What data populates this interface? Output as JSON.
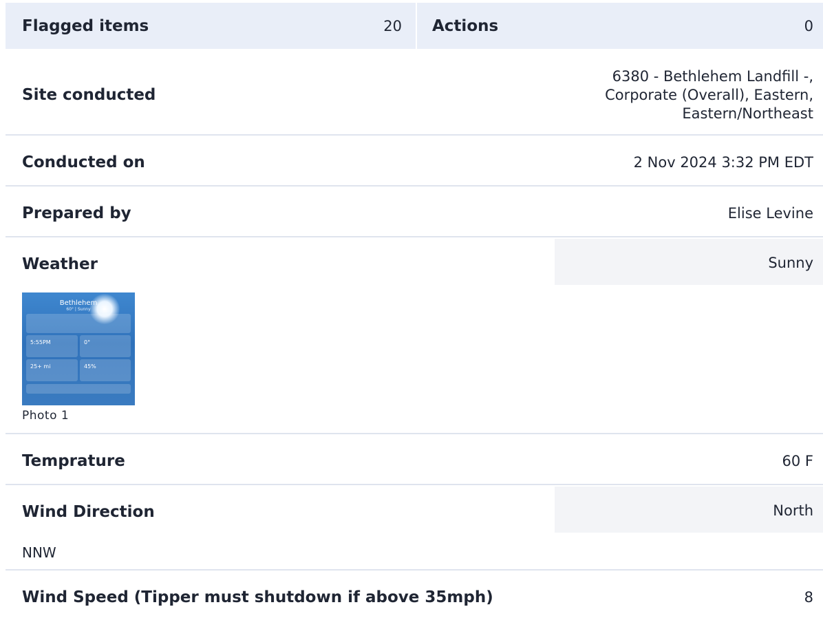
{
  "summary": {
    "flagged_label": "Flagged items",
    "flagged_value": "20",
    "actions_label": "Actions",
    "actions_value": "0"
  },
  "fields": {
    "site": {
      "label": "Site conducted",
      "value_lines": [
        "6380 - Bethlehem Landfill -,",
        "Corporate (Overall), Eastern,",
        "Eastern/Northeast"
      ]
    },
    "conducted_on": {
      "label": "Conducted on",
      "value": "2 Nov 2024 3:32 PM EDT"
    },
    "prepared_by": {
      "label": "Prepared by",
      "value": "Elise Levine"
    },
    "weather": {
      "label": "Weather",
      "value": "Sunny",
      "photo": {
        "caption": "Photo 1",
        "city": "Bethlehem",
        "subtitle": "60° | Sunny",
        "tiles": [
          "5:55PM",
          "0°",
          "25+ mi",
          "45%"
        ]
      }
    },
    "temperature": {
      "label": "Temprature",
      "value": "60 F"
    },
    "wind_direction": {
      "label": "Wind Direction",
      "value": "North",
      "note": "NNW"
    },
    "wind_speed": {
      "label": "Wind Speed (Tipper must shutdown if above 35mph)",
      "value": "8"
    }
  },
  "colors": {
    "header_bg": "#e9eef8",
    "highlight_bg": "#f3f4f7",
    "divider": "#dfe4ee",
    "text": "#1f2533"
  }
}
